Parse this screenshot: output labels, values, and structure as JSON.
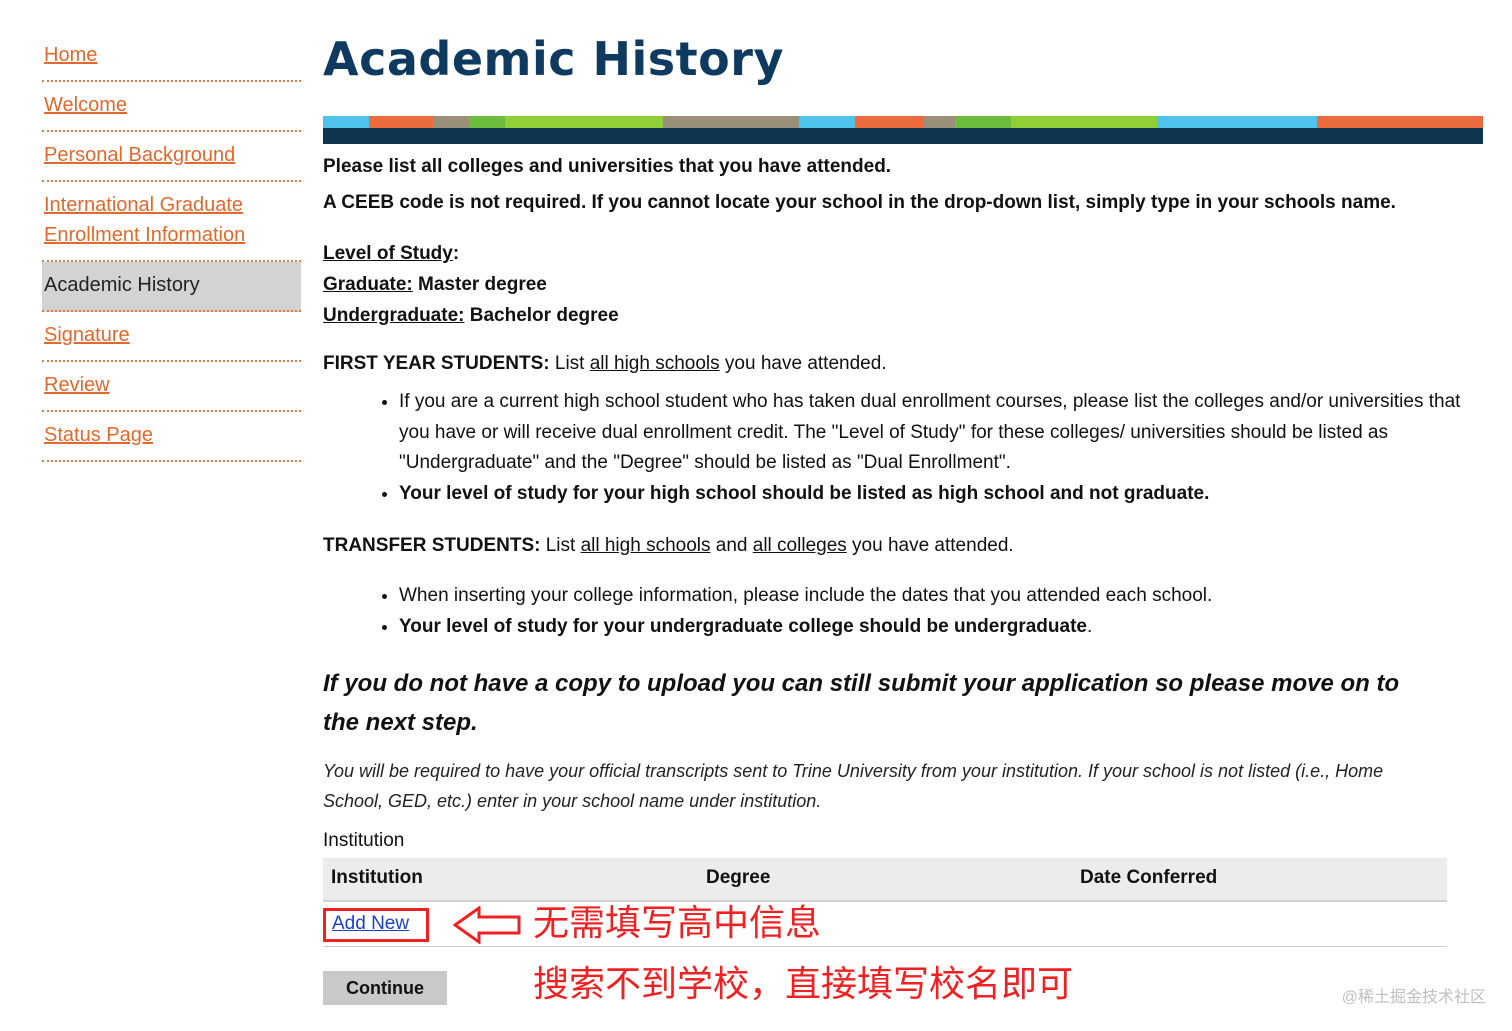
{
  "sidebar": {
    "items": [
      {
        "label": "Home"
      },
      {
        "label": "Welcome"
      },
      {
        "label": "Personal Background"
      },
      {
        "label": "International Graduate Enrollment Information"
      },
      {
        "label": "Academic History"
      },
      {
        "label": "Signature"
      },
      {
        "label": "Review"
      },
      {
        "label": "Status Page"
      }
    ]
  },
  "page": {
    "title": "Academic History",
    "intro1": "Please list all colleges and universities that you have attended.",
    "intro2": "A CEEB code is not required. If you cannot locate your school in the drop-down list, simply type in your schools name.",
    "level": {
      "heading": "Level of Study",
      "colon": ":",
      "grad_label": "Graduate:",
      "grad_value": " Master degree",
      "ugrad_label": "Undergraduate:",
      "ugrad_value": " Bachelor degree"
    },
    "first_year": {
      "label": "FIRST YEAR STUDENTS:",
      "pre": " List ",
      "link": "all high schools",
      "post": " you have attended.",
      "bullet1": "If you are a current high school student who has taken dual enrollment courses, please list the colleges and/or universities that you have or will receive dual enrollment credit. The \"Level of Study\" for these colleges/ universities should be listed as \"Undergraduate\" and the \"Degree\" should be listed as \"Dual Enrollment\".",
      "bullet2": "Your level of study for your high school should be listed as high school and not graduate."
    },
    "transfer": {
      "label": "TRANSFER STUDENTS:",
      "pre": " List ",
      "link1": "all high schools",
      "mid": " and ",
      "link2": "all colleges",
      "post": " you have attended.",
      "bullet1": "When inserting your college information, please include the dates that you attended each school.",
      "bullet2": "Your level of study for your undergraduate college should be undergraduate",
      "bullet2_end": "."
    },
    "notice": "If you do not have a copy to upload you can still submit your application so please move on to the next step.",
    "note": "You will be required to have your official transcripts sent to Trine University from your institution.  If your school is not listed (i.e., Home School, GED, etc.) enter in your school name under institution.",
    "institution_label": "Institution",
    "table": {
      "headers": [
        "Institution",
        "Degree",
        "Date Conferred"
      ],
      "add_new": "Add New"
    },
    "continue_label": "Continue",
    "annotation1": "无需填写高中信息",
    "annotation2": "搜索不到学校，直接填写校名即可",
    "watermark": "@稀土掘金技术社区"
  },
  "colors": {
    "title": "#0d3a5e",
    "link": "#e2692c",
    "annotation": "#ee2222",
    "banner_navy": "#0f3650"
  }
}
